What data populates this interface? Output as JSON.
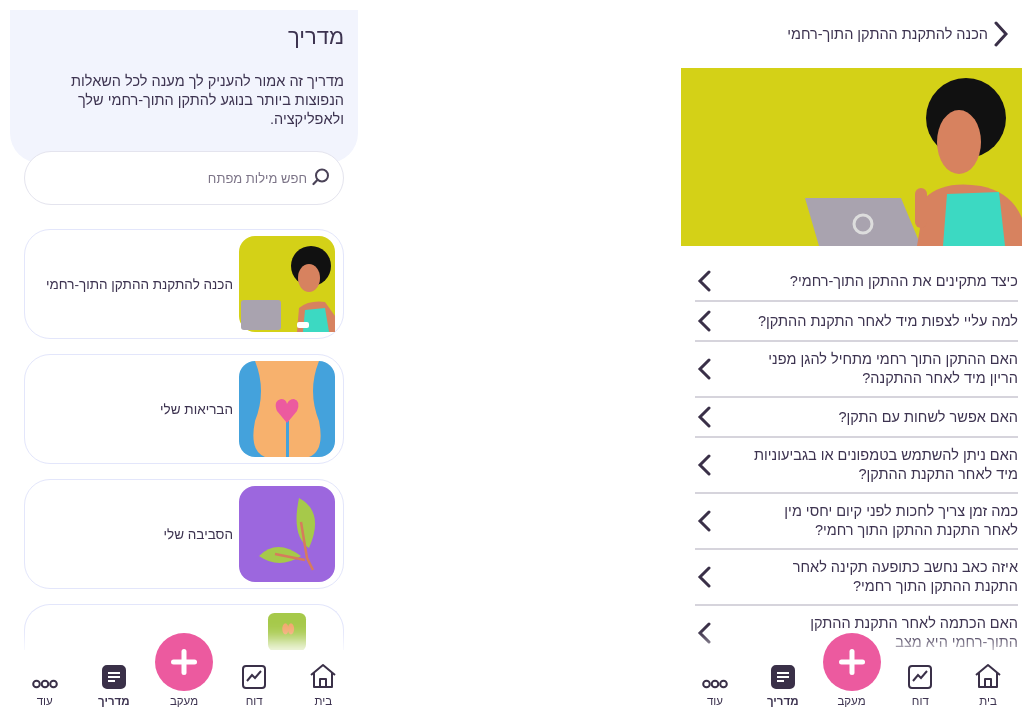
{
  "guide": {
    "title": "מדריך",
    "description": "מדריך זה אמור להעניק לך מענה לכל  השאלות הנפוצות ביותר בנוגע להתקן התוך-רחמי שלך ולאפליקציה.",
    "search": {
      "placeholder": "חפש מילות מפתח"
    },
    "topics": [
      {
        "title": "הכנה להתקנת ההתקן התוך-רחמי",
        "kind": "laptop"
      },
      {
        "title": "הבריאות שלי",
        "kind": "heart"
      },
      {
        "title": "הסביבה שלי",
        "kind": "leaf"
      },
      {
        "kind": "hands"
      }
    ],
    "nav": [
      {
        "label": "בית",
        "kind": "home",
        "selected": false
      },
      {
        "label": "דוח",
        "kind": "report",
        "selected": false
      },
      {
        "label": "מעקב",
        "kind": "add"
      },
      {
        "label": "מדריך",
        "kind": "guide",
        "selected": true
      },
      {
        "label": "עוד",
        "kind": "more",
        "selected": false
      }
    ]
  },
  "article": {
    "title": "הכנה להתקנת ההתקן התוך-רחמי",
    "questions": [
      "כיצד מתקינים את ההתקן התוך-רחמי?",
      "למה עליי לצפות מיד לאחר התקנת ההתקן?",
      "האם ההתקן התוך רחמי מתחיל להגן מפני הריון מיד לאחר ההתקנה?",
      "האם אפשר לשחות עם התקן?",
      "האם ניתן להשתמש בטמפונים או בגביעוניות מיד לאחר התקנת ההתקן?",
      "כמה זמן צריך לחכות לפני קיום יחסי מין לאחר התקנת ההתקן התוך רחמי?",
      "איזה כאב נחשב כתופעה תקינה לאחר התקנת ההתקן התוך רחמי?",
      "האם הכתמה לאחר התקנת ההתקן התוך-רחמי היא מצב"
    ],
    "nav": [
      {
        "label": "בית",
        "kind": "home",
        "selected": false
      },
      {
        "label": "דוח",
        "kind": "report",
        "selected": false
      },
      {
        "label": "מעקב",
        "kind": "add"
      },
      {
        "label": "מדריך",
        "kind": "guide",
        "selected": true
      },
      {
        "label": "עוד",
        "kind": "more",
        "selected": false
      }
    ]
  }
}
